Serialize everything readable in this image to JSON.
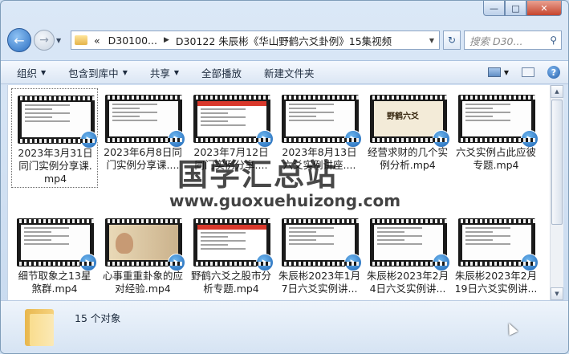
{
  "address": {
    "crumbs": [
      "D30100...",
      "D30122 朱辰彬《华山野鹤六爻卦例》15集视频"
    ],
    "prefix": "«"
  },
  "search": {
    "placeholder": "搜索 D30..."
  },
  "toolbar": {
    "organize": "组织",
    "include_library": "包含到库中",
    "share": "共享",
    "play_all": "全部播放",
    "new_folder": "新建文件夹"
  },
  "files": [
    {
      "name": "2023年3月31日同门实例分享课.mp4",
      "line1": "2023年3月31日",
      "line2": "同门实例分享课.",
      "line3": "mp4",
      "selected": true
    },
    {
      "name": "2023年6月8日同门实例分享课....",
      "line1": "2023年6月8日同",
      "line2": "门实例分享课....",
      "line3": ""
    },
    {
      "name": "2023年7月12日同门实例分享....",
      "line1": "2023年7月12日",
      "line2": "同门实例分享....",
      "line3": ""
    },
    {
      "name": "2023年8月13日六爻实例讲座....",
      "line1": "2023年8月13日",
      "line2": "六爻实例讲座....",
      "line3": ""
    },
    {
      "name": "经营求财的几个实例分析.mp4",
      "line1": "经营求财的几个实",
      "line2": "例分析.mp4",
      "line3": ""
    },
    {
      "name": "六爻实例占此应彼专题.mp4",
      "line1": "六爻实例占此应彼",
      "line2": "专题.mp4",
      "line3": ""
    },
    {
      "name": "细节取象之13星煞群.mp4",
      "line1": "细节取象之13星",
      "line2": "煞群.mp4",
      "line3": ""
    },
    {
      "name": "心事重重卦象的应对经验.mp4",
      "line1": "心事重重卦象的应",
      "line2": "对经验.mp4",
      "line3": ""
    },
    {
      "name": "野鹤六爻之股市分析专题.mp4",
      "line1": "野鹤六爻之股市分",
      "line2": "析专题.mp4",
      "line3": ""
    },
    {
      "name": "朱辰彬2023年1月7日六爻实例讲....",
      "line1": "朱辰彬2023年1月",
      "line2": "7日六爻实例讲...",
      "line3": ""
    },
    {
      "name": "朱辰彬2023年2月4日六爻实例讲....",
      "line1": "朱辰彬2023年2月",
      "line2": "4日六爻实例讲...",
      "line3": ""
    },
    {
      "name": "朱辰彬2023年2月19日六爻实例讲....",
      "line1": "朱辰彬2023年2月",
      "line2": "19日六爻实例讲...",
      "line3": ""
    }
  ],
  "thumb_text": {
    "yehe": "野鹤六爻"
  },
  "watermark": {
    "cn": "国学汇总站",
    "url": "www.guoxuehuizong.com"
  },
  "status": {
    "count": "15 个对象"
  },
  "help": "?"
}
